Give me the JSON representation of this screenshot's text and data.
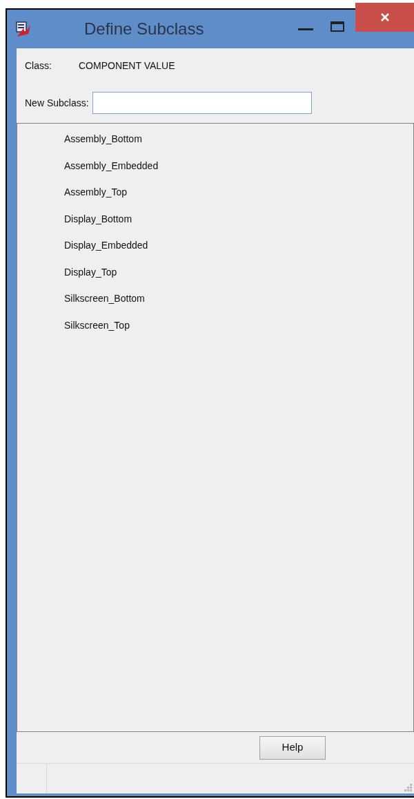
{
  "window": {
    "title": "Define Subclass"
  },
  "class_row": {
    "label": "Class:",
    "value": "COMPONENT VALUE"
  },
  "new_subclass": {
    "label": "New Subclass:"
  },
  "subclasses": [
    "Assembly_Bottom",
    "Assembly_Embedded",
    "Assembly_Top",
    "Display_Bottom",
    "Display_Embedded",
    "Display_Top",
    "Silkscreen_Bottom",
    "Silkscreen_Top"
  ],
  "buttons": [
    "Help"
  ]
}
